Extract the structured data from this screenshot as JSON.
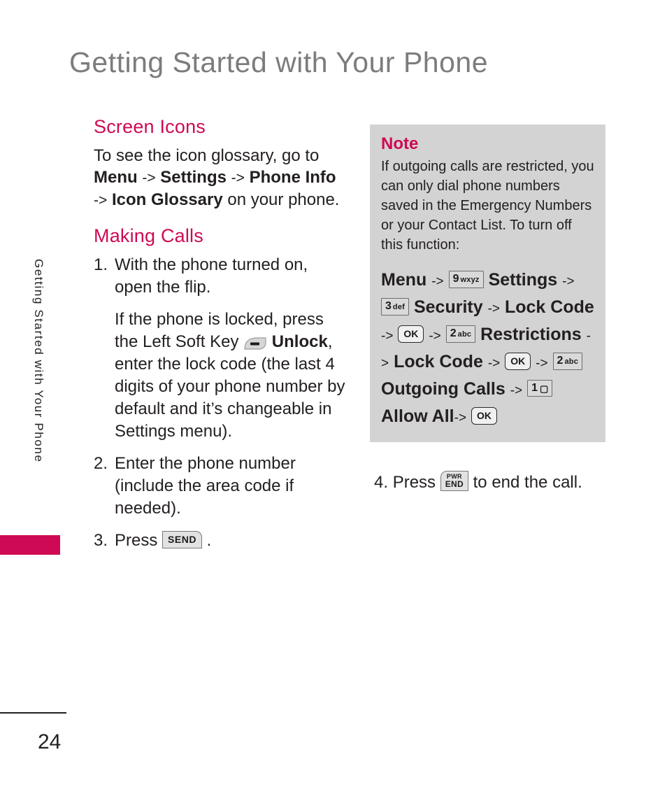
{
  "document": {
    "chapter_title": "Getting Started with Your Phone",
    "side_tab_label": "Getting Started with Your Phone",
    "page_number": "24"
  },
  "colors": {
    "accent": "#ce0a54",
    "title_gray": "#7c7c7c",
    "note_background": "#d3d3d3",
    "body": "#231f20"
  },
  "left_column": {
    "screen_icons": {
      "heading": "Screen Icons",
      "line1": "To see the icon glossary, go to",
      "menu": "Menu",
      "arrow1": "->",
      "settings": "Settings",
      "arrow2": "->",
      "phone_info": "Phone Info",
      "arrow3": "->",
      "icon_glossary": "Icon Glossary",
      "tail": "on your phone."
    },
    "making_calls": {
      "heading": "Making Calls",
      "steps": [
        {
          "num": "1.",
          "text": "With the phone turned on, open the flip.",
          "sub_before": "If the phone is locked, press the Left Soft Key",
          "sub_key_icon": "left-soft-key",
          "sub_bold": "Unlock",
          "sub_after": ", enter the lock code (the last 4 digits of your phone number by default and it’s changeable in Settings menu)."
        },
        {
          "num": "2.",
          "text": "Enter the phone number (include the area code if needed)."
        },
        {
          "num": "3.",
          "text_before": "Press",
          "key_icon": "send-key",
          "key_label": "SEND",
          "text_after": "."
        }
      ]
    }
  },
  "right_column": {
    "note": {
      "title": "Note",
      "body": "If outgoing calls are restricted, you can only dial phone numbers saved in the Emergency Numbers or your Contact List. To turn off this function:",
      "sequence": {
        "menu": "Menu",
        "arrow": "->",
        "key9_digit": "9",
        "key9_letters": "wxyz",
        "settings": "Settings",
        "key3_digit": "3",
        "key3_letters": "def",
        "security": "Security",
        "lock_code": "Lock Code",
        "ok": "OK",
        "key2_digit": "2",
        "key2_letters": "abc",
        "restrictions": "Restrictions",
        "lock_code_2": "Lock Code",
        "ok_2": "OK",
        "key2b_digit": "2",
        "key2b_letters": "abc",
        "outgoing_calls": "Outgoing Calls",
        "key1_digit": "1",
        "key1_glyph": "voicemail",
        "allow_all": "Allow All",
        "ok_3": "OK"
      }
    },
    "step4": {
      "num": "4.",
      "text_before": "Press",
      "key_icon": "pwr-end-key",
      "key_top_label": "PWR",
      "key_bottom_label": "END",
      "text_after": "to end the call."
    }
  }
}
